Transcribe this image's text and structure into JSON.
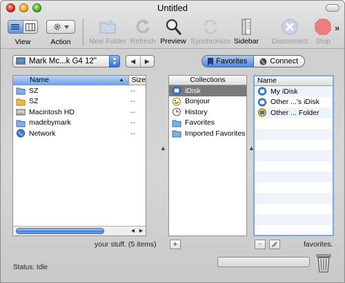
{
  "window": {
    "title": "Untitled"
  },
  "toolbar": {
    "view_label": "View",
    "action_label": "Action",
    "new_folder_label": "New Folder",
    "refresh_label": "Refresh",
    "preview_label": "Preview",
    "synchronize_label": "Synchronize",
    "sidebar_label": "Sidebar",
    "disconnect_label": "Disconnect",
    "stop_label": "Stop",
    "overflow_label": "»"
  },
  "computer_popup": {
    "value": "Mark Mc...k G4 12\""
  },
  "tabs": {
    "favorites_label": "Favorites",
    "connect_label": "Connect"
  },
  "left_pane": {
    "col_name": "Name",
    "col_size": "Size",
    "rows": [
      {
        "name": "SZ",
        "size": "--",
        "icon": "folder-icon"
      },
      {
        "name": "SZ",
        "size": "--",
        "icon": "ipod-drive-icon"
      },
      {
        "name": "Macintosh HD",
        "size": "--",
        "icon": "hard-drive-icon"
      },
      {
        "name": "madebymark",
        "size": "--",
        "icon": "folder-icon"
      },
      {
        "name": "Network",
        "size": "--",
        "icon": "globe-icon"
      }
    ],
    "footer_note": "your stuff. (5 items)"
  },
  "mid_pane": {
    "header": "Collections",
    "rows": [
      {
        "name": "iDisk",
        "icon": "idisk-icon"
      },
      {
        "name": "Bonjour",
        "icon": "bonjour-icon"
      },
      {
        "name": "History",
        "icon": "clock-icon"
      },
      {
        "name": "Favorites",
        "icon": "folder-icon"
      },
      {
        "name": "Imported Favorites",
        "icon": "folder-icon"
      }
    ],
    "add_label": "+"
  },
  "right_pane": {
    "col_name": "Name",
    "rows": [
      {
        "name": "My iDisk",
        "icon": "idisk-icon"
      },
      {
        "name": "Other ...'s iDisk",
        "icon": "idisk-icon"
      },
      {
        "name": "Other ... Folder",
        "icon": "public-folder-icon"
      }
    ],
    "add_label": "+",
    "footer_note": "favorites."
  },
  "status": {
    "text": "Status: Idle"
  },
  "colors": {
    "selection": "#7a7a7a",
    "accent_blue": "#4c86dc"
  }
}
